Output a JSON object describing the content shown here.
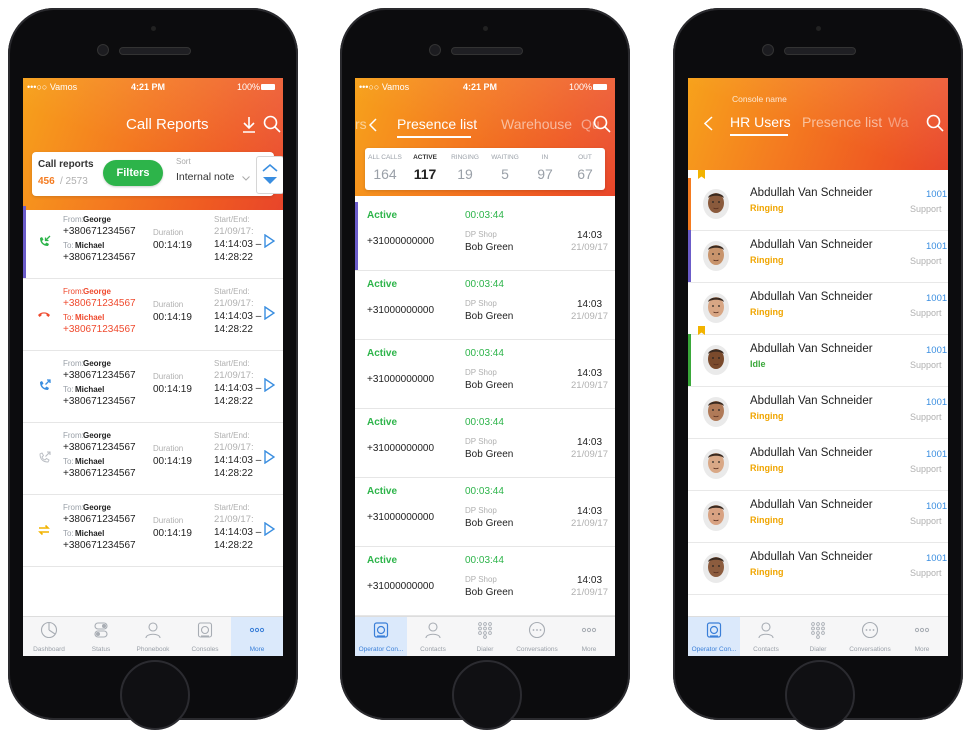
{
  "status": {
    "carrier": "•••○○ Vamos",
    "time": "4:21 PM",
    "battery": "100%"
  },
  "screen1": {
    "title": "Call Reports",
    "call_reports_label": "Call reports",
    "count_main": "456",
    "count_total": "/ 2573",
    "filters_label": "Filters",
    "sort_label": "Sort",
    "sort_value": "Internal note",
    "duration_label": "Duration",
    "startend_label": "Start/End:",
    "rows": [
      {
        "from_label": "From:",
        "from": "George",
        "from_num": "+380671234567",
        "to_label": "To:",
        "to": "Michael",
        "to_num": "+380671234567",
        "duration": "00:14:19",
        "date": "21/09/17:",
        "start": "14:14:03 –",
        "end": "14:28:22",
        "icon": "incoming-call-icon",
        "color": "#2db44a",
        "missed": false
      },
      {
        "from_label": "From:",
        "from": "George",
        "from_num": "+380671234567",
        "to_label": "To:",
        "to": "Michael",
        "to_num": "+380671234567",
        "duration": "00:14:19",
        "date": "21/09/17:",
        "start": "14:14:03 –",
        "end": "14:28:22",
        "icon": "missed-call-icon",
        "color": "#ef4a2e",
        "missed": true
      },
      {
        "from_label": "From:",
        "from": "George",
        "from_num": "+380671234567",
        "to_label": "To:",
        "to": "Michael",
        "to_num": "+380671234567",
        "duration": "00:14:19",
        "date": "21/09/17:",
        "start": "14:14:03 –",
        "end": "14:28:22",
        "icon": "outgoing-call-icon",
        "color": "#3a8ee0",
        "missed": false
      },
      {
        "from_label": "From:",
        "from": "George",
        "from_num": "+380671234567",
        "to_label": "To:",
        "to": "Michael",
        "to_num": "+380671234567",
        "duration": "00:14:19",
        "date": "21/09/17:",
        "start": "14:14:03 –",
        "end": "14:28:22",
        "icon": "outgoing-call-gray-icon",
        "color": "#b8bcc2",
        "missed": false
      },
      {
        "from_label": "From:",
        "from": "George",
        "from_num": "+380671234567",
        "to_label": "To:",
        "to": "Michael",
        "to_num": "+380671234567",
        "duration": "00:14:19",
        "date": "21/09/17:",
        "start": "14:14:03 –",
        "end": "14:28:22",
        "icon": "transfer-call-icon",
        "color": "#f2b300",
        "missed": false
      }
    ],
    "tabs": [
      "Dashboard",
      "Status",
      "Phonebook",
      "Consoles",
      "More"
    ]
  },
  "screen2": {
    "tabs": [
      "rs",
      "Presence list",
      "Warehouse",
      "Qu"
    ],
    "stats": [
      {
        "label": "ALL CALLS",
        "value": "164"
      },
      {
        "label": "ACTIVE",
        "value": "117"
      },
      {
        "label": "RINGING",
        "value": "19"
      },
      {
        "label": "WAITING",
        "value": "5"
      },
      {
        "label": "IN",
        "value": "97"
      },
      {
        "label": "OUT",
        "value": "67"
      }
    ],
    "rows": [
      {
        "status": "Active",
        "time": "00:03:44",
        "number": "+31000000000",
        "queue": "DP Shop",
        "agent": "Bob Green",
        "clock": "14:03",
        "date": "21/09/17"
      },
      {
        "status": "Active",
        "time": "00:03:44",
        "number": "+31000000000",
        "queue": "DP Shop",
        "agent": "Bob Green",
        "clock": "14:03",
        "date": "21/09/17"
      },
      {
        "status": "Active",
        "time": "00:03:44",
        "number": "+31000000000",
        "queue": "DP Shop",
        "agent": "Bob Green",
        "clock": "14:03",
        "date": "21/09/17"
      },
      {
        "status": "Active",
        "time": "00:03:44",
        "number": "+31000000000",
        "queue": "DP Shop",
        "agent": "Bob Green",
        "clock": "14:03",
        "date": "21/09/17"
      },
      {
        "status": "Active",
        "time": "00:03:44",
        "number": "+31000000000",
        "queue": "DP Shop",
        "agent": "Bob Green",
        "clock": "14:03",
        "date": "21/09/17"
      },
      {
        "status": "Active",
        "time": "00:03:44",
        "number": "+31000000000",
        "queue": "DP Shop",
        "agent": "Bob Green",
        "clock": "14:03",
        "date": "21/09/17"
      }
    ],
    "tabbar": [
      "Operator Con...",
      "Contacts",
      "Dialer",
      "Conversations",
      "More"
    ]
  },
  "screen3": {
    "console_label": "Console name",
    "tabs": [
      "HR Users",
      "Presence list",
      "Wa"
    ],
    "rows": [
      {
        "name": "Abdullah Van Schneider",
        "status": "Ringing",
        "ext": "1001",
        "dept": "Support",
        "status_color": "#f0a500",
        "flag": true,
        "bar": "#f47b20"
      },
      {
        "name": "Abdullah Van Schneider",
        "status": "Ringing",
        "ext": "1001",
        "dept": "Support",
        "status_color": "#f0a500",
        "flag": false,
        "bar": "#6b5cc9"
      },
      {
        "name": "Abdullah Van Schneider",
        "status": "Ringing",
        "ext": "1001",
        "dept": "Support",
        "status_color": "#f0a500",
        "flag": false,
        "bar": ""
      },
      {
        "name": "Abdullah Van Schneider",
        "status": "Idle",
        "ext": "1001",
        "dept": "Support",
        "status_color": "#3aa83a",
        "flag": true,
        "bar": "#3aa83a"
      },
      {
        "name": "Abdullah Van Schneider",
        "status": "Ringing",
        "ext": "1001",
        "dept": "Support",
        "status_color": "#f0a500",
        "flag": false,
        "bar": ""
      },
      {
        "name": "Abdullah Van Schneider",
        "status": "Ringing",
        "ext": "1001",
        "dept": "Support",
        "status_color": "#f0a500",
        "flag": false,
        "bar": ""
      },
      {
        "name": "Abdullah Van Schneider",
        "status": "Ringing",
        "ext": "1001",
        "dept": "Support",
        "status_color": "#f0a500",
        "flag": false,
        "bar": ""
      },
      {
        "name": "Abdullah Van Schneider",
        "status": "Ringing",
        "ext": "1001",
        "dept": "Support",
        "status_color": "#f0a500",
        "flag": false,
        "bar": ""
      }
    ],
    "tabbar": [
      "Operator Con...",
      "Contacts",
      "Dialer",
      "Conversations",
      "More"
    ]
  }
}
